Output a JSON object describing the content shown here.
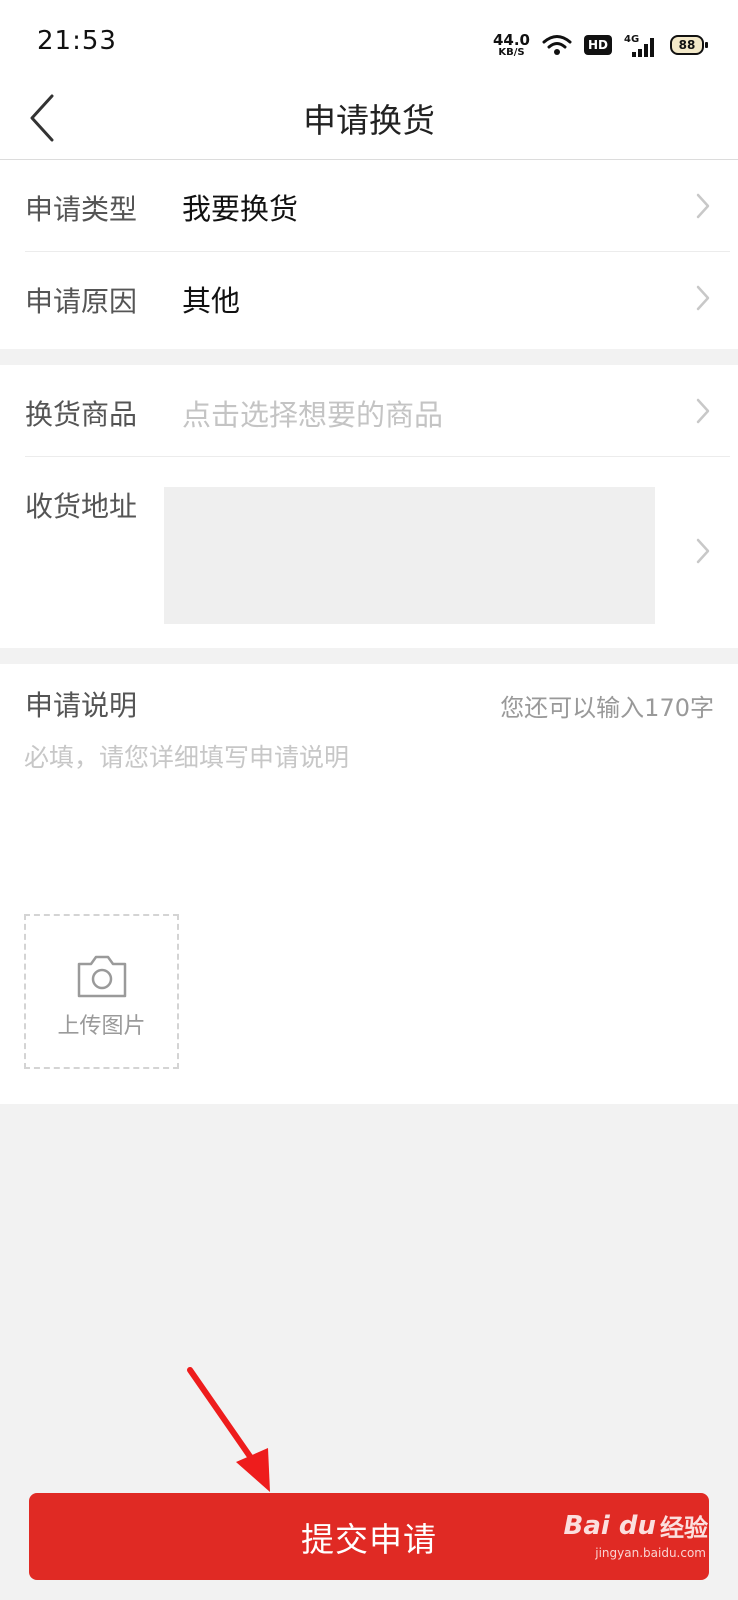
{
  "status_bar": {
    "time": "21:53",
    "net_speed": "44.0",
    "net_speed_unit": "KB/S",
    "hd_badge": "HD",
    "network": "4G",
    "battery": "88"
  },
  "header": {
    "title": "申请换货"
  },
  "form": {
    "type": {
      "label": "申请类型",
      "value": "我要换货"
    },
    "reason": {
      "label": "申请原因",
      "value": "其他"
    },
    "goods": {
      "label": "换货商品",
      "placeholder": "点击选择想要的商品"
    },
    "address": {
      "label": "收货地址"
    },
    "description": {
      "label": "申请说明",
      "counter": "您还可以输入170字",
      "placeholder": "必填，请您详细填写申请说明"
    },
    "upload": {
      "label": "上传图片"
    }
  },
  "submit": {
    "label": "提交申请"
  },
  "watermark": {
    "brand": "Bai du",
    "cn": "经验",
    "url": "jingyan.baidu.com"
  },
  "colors": {
    "accent": "#e02a24",
    "background": "#f2f2f2"
  }
}
